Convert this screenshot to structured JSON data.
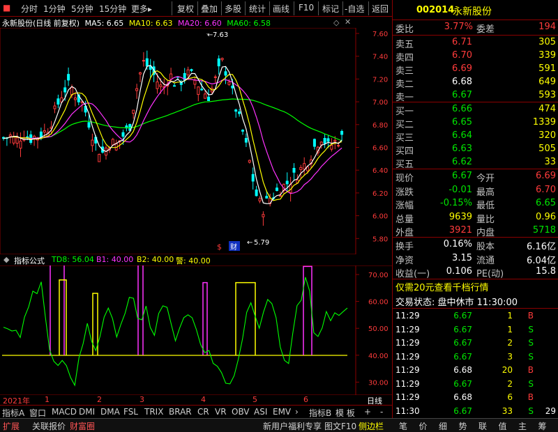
{
  "toolbar": {
    "items": [
      "分时",
      "1分钟",
      "5分钟",
      "15分钟",
      "更多",
      "复权",
      "叠加",
      "多股",
      "统计",
      "画线",
      "F10",
      "标记",
      "-自选",
      "返回"
    ]
  },
  "main_chart": {
    "title": "永新股份(日线 前复权)",
    "ma": [
      {
        "label": "MA5: 6.65",
        "color": "#ffffff"
      },
      {
        "label": "MA10: 6.63",
        "color": "#ffff00"
      },
      {
        "label": "MA20: 6.60",
        "color": "#ff33ff"
      },
      {
        "label": "MA60: 6.58",
        "color": "#00ff00"
      }
    ],
    "y_ticks": [
      "7.60",
      "7.40",
      "7.20",
      "7.00",
      "6.80",
      "6.60",
      "6.40",
      "6.20",
      "6.00",
      "5.80"
    ],
    "high_label": "7.63",
    "low_label": "5.79",
    "markers": [
      "$",
      "财"
    ]
  },
  "indicator": {
    "title": "指标公式",
    "values": [
      {
        "label": "TD8: 56.04",
        "color": "#00ff00"
      },
      {
        "label": "B1: 40.00",
        "color": "#ff33ff"
      },
      {
        "label": "B2: 40.00",
        "color": "#ffff00"
      },
      {
        "label": "警: 40.00",
        "color": "#ffff00"
      }
    ],
    "y_ticks": [
      "70.00",
      "60.00",
      "50.00",
      "40.00",
      "30.00"
    ]
  },
  "date_axis": {
    "year": "2021年",
    "months": [
      "1",
      "2",
      "3",
      "4",
      "5",
      "6"
    ],
    "period": "日线"
  },
  "bottom_tabs": [
    "指标A",
    "窗口",
    "MACD",
    "DMI",
    "DMA",
    "FSL",
    "TRIX",
    "BRAR",
    "CR",
    "VR",
    "OBV",
    "ASI",
    "EMV",
    "指标B",
    "模 板",
    "+",
    "-"
  ],
  "status_bar": {
    "items": [
      "扩展",
      "关联报价",
      "财富圈",
      "新用户福利专享",
      "图文F10",
      "侧边栏"
    ],
    "right_icons": [
      "笔",
      "价",
      "细",
      "势",
      "联",
      "值",
      "主",
      "筹"
    ]
  },
  "quote": {
    "code": "002014",
    "name": "永新股份",
    "weibi_label": "委比",
    "weibi_value": "3.77%",
    "weicha_label": "委差",
    "weicha_value": "194",
    "asks": [
      {
        "label": "卖五",
        "price": "6.71",
        "vol": "305"
      },
      {
        "label": "卖四",
        "price": "6.70",
        "vol": "339"
      },
      {
        "label": "卖三",
        "price": "6.69",
        "vol": "591"
      },
      {
        "label": "卖二",
        "price": "6.68",
        "vol": "649"
      },
      {
        "label": "卖一",
        "price": "6.67",
        "vol": "593"
      }
    ],
    "bids": [
      {
        "label": "买一",
        "price": "6.66",
        "vol": "474"
      },
      {
        "label": "买二",
        "price": "6.65",
        "vol": "1339"
      },
      {
        "label": "买三",
        "price": "6.64",
        "vol": "320"
      },
      {
        "label": "买四",
        "price": "6.63",
        "vol": "505"
      },
      {
        "label": "买五",
        "price": "6.62",
        "vol": "33"
      }
    ],
    "stats": [
      {
        "l1": "现价",
        "v1": "6.67",
        "l2": "今开",
        "v2": "6.69"
      },
      {
        "l1": "涨跌",
        "v1": "-0.01",
        "l2": "最高",
        "v2": "6.70"
      },
      {
        "l1": "涨幅",
        "v1": "-0.15%",
        "l2": "最低",
        "v2": "6.65"
      },
      {
        "l1": "总量",
        "v1": "9639",
        "l2": "量比",
        "v2": "0.96"
      },
      {
        "l1": "外盘",
        "v1": "3921",
        "l2": "内盘",
        "v2": "5718"
      }
    ],
    "stats2": [
      {
        "l1": "换手",
        "v1": "0.16%",
        "l2": "股本",
        "v2": "6.16亿"
      },
      {
        "l1": "净资",
        "v1": "3.15",
        "l2": "流通",
        "v2": "6.04亿"
      },
      {
        "l1": "收益(一)",
        "v1": "0.106",
        "l2": "PE(动)",
        "v2": "15.8"
      }
    ],
    "promo": "仅需20元查看千档行情",
    "trade_status": "交易状态: 盘中休市 11:30:00",
    "trades": [
      {
        "time": "11:29",
        "price": "6.67",
        "vol": "1",
        "side": "B"
      },
      {
        "time": "11:29",
        "price": "6.67",
        "vol": "1",
        "side": "S"
      },
      {
        "time": "11:29",
        "price": "6.67",
        "vol": "2",
        "side": "S"
      },
      {
        "time": "11:29",
        "price": "6.67",
        "vol": "3",
        "side": "S"
      },
      {
        "time": "11:29",
        "price": "6.68",
        "vol": "20",
        "side": "B"
      },
      {
        "time": "11:29",
        "price": "6.67",
        "vol": "2",
        "side": "S"
      },
      {
        "time": "11:29",
        "price": "6.68",
        "vol": "6",
        "side": "B"
      },
      {
        "time": "11:30",
        "price": "6.67",
        "vol": "33",
        "side": "S",
        "extra": "29"
      }
    ]
  }
}
